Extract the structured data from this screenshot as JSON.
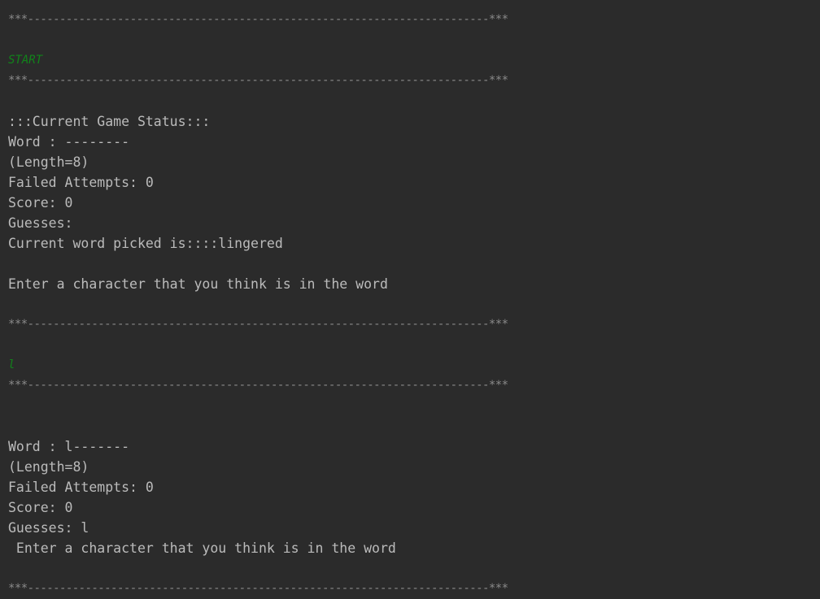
{
  "colors": {
    "background": "#2b2b2b",
    "text": "#bbbbbb",
    "rule": "#8a8a8a",
    "user_input": "#11831a"
  },
  "console": {
    "separator": "***------------------------------------------------------------------------***",
    "block1": {
      "input": "START",
      "status_header": ":::Current Game Status:::",
      "word": "Word : --------",
      "length": "(Length=8)",
      "failed_attempts": "Failed Attempts: 0",
      "score": "Score: 0",
      "guesses": "Guesses:",
      "current_word": "Current word picked is::::lingered",
      "prompt": "Enter a character that you think is in the word"
    },
    "block2": {
      "input": "l",
      "word": "Word : l-------",
      "length": "(Length=8)",
      "failed_attempts": "Failed Attempts: 0",
      "score": "Score: 0",
      "guesses": "Guesses: l",
      "prompt": " Enter a character that you think is in the word"
    }
  }
}
